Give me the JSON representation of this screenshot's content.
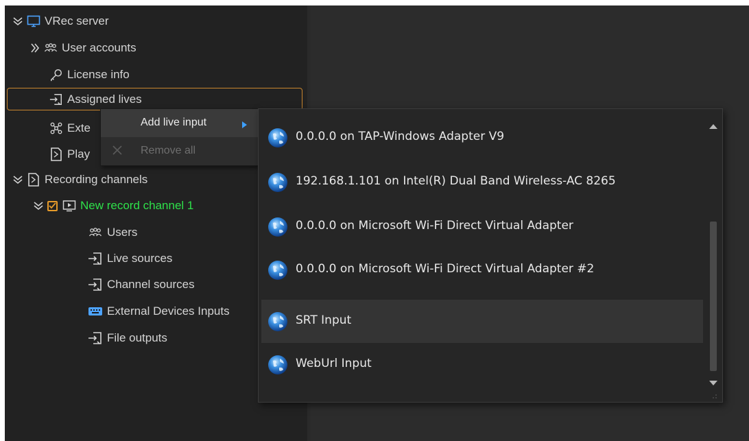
{
  "tree": {
    "root_label": "VRec server",
    "items": [
      {
        "label": "User accounts"
      },
      {
        "label": "License info"
      },
      {
        "label": "Assigned lives"
      },
      {
        "label": "Exte"
      },
      {
        "label": "Play"
      },
      {
        "label": "Recording channels"
      }
    ],
    "channel": {
      "label": "New record channel 1",
      "checked": true,
      "children": [
        {
          "label": "Users"
        },
        {
          "label": "Live sources"
        },
        {
          "label": "Channel sources"
        },
        {
          "label": "External Devices Inputs"
        },
        {
          "label": "File outputs"
        }
      ]
    }
  },
  "context_menu": {
    "add_live_input": "Add live input",
    "remove_all": "Remove all"
  },
  "submenu": {
    "items": [
      {
        "label": "0.0.0.0 on TAP-Windows Adapter V9"
      },
      {
        "label": "192.168.1.101 on Intel(R) Dual Band Wireless-AC 8265"
      },
      {
        "label": "0.0.0.0 on Microsoft Wi-Fi Direct Virtual Adapter"
      },
      {
        "label": "0.0.0.0 on Microsoft Wi-Fi Direct Virtual Adapter #2"
      },
      {
        "label": "SRT Input"
      },
      {
        "label": "WebUrl Input"
      }
    ]
  },
  "colors": {
    "panel_bg": "#222222",
    "selection_border": "#c9862e",
    "channel_green": "#2ee04a",
    "checkbox_orange": "#e59a2a",
    "menu_arrow_blue": "#3ea0ff"
  }
}
